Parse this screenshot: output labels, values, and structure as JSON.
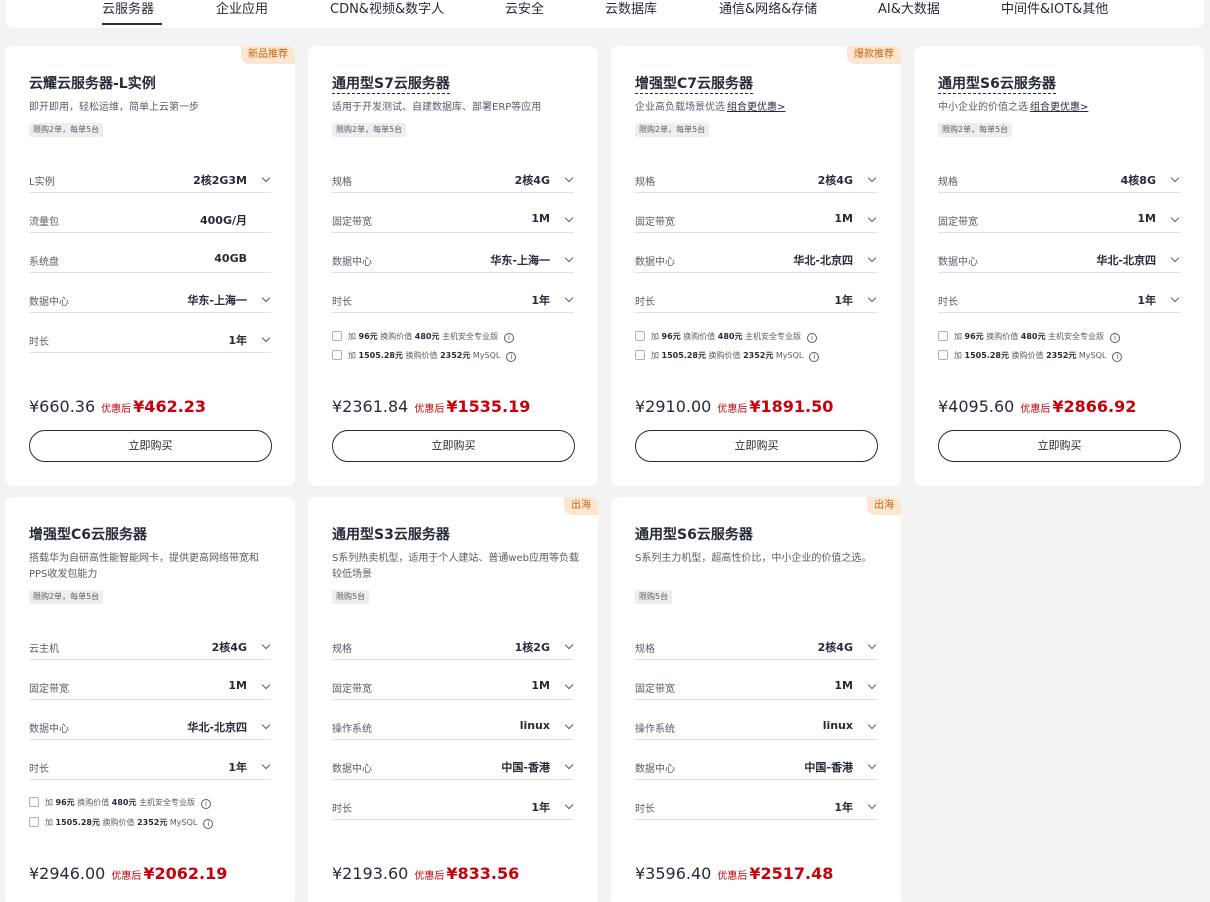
{
  "tabs": [
    {
      "label": "云服务器",
      "active": true
    },
    {
      "label": "企业应用",
      "active": false
    },
    {
      "label": "CDN&视频&数字人",
      "active": false
    },
    {
      "label": "云安全",
      "active": false
    },
    {
      "label": "云数据库",
      "active": false
    },
    {
      "label": "通信&网络&存储",
      "active": false
    },
    {
      "label": "AI&大数据",
      "active": false
    },
    {
      "label": "中间件&IOT&其他",
      "active": false
    }
  ],
  "common": {
    "buy_label": "立即购买",
    "after_discount_label": "优惠后",
    "combo_link": "组合更优惠>",
    "addon_1_prefix": "加",
    "addon_1_price": "96元",
    "addon_1_mid": "换购价值",
    "addon_1_value": "480元",
    "addon_1_suffix": "主机安全专业版",
    "addon_2_prefix": "加",
    "addon_2_price": "1505.28元",
    "addon_2_mid": "换购价值",
    "addon_2_value": "2352元",
    "addon_2_suffix": "MySQL",
    "info_glyph": "i"
  },
  "colors": {
    "accent_red": "#c7000b",
    "badge_bg": "#fbe6d2",
    "badge_text": "#c7670e",
    "text_primary": "#252b3a"
  },
  "cards": [
    {
      "title": "云耀云服务器-L实例",
      "badge": "新品推荐",
      "desc": "即开即用，轻松运维，简单上云第一步",
      "limit": "限购2单，每单5台",
      "specs": [
        {
          "label": "L实例",
          "value": "2核2G3M"
        },
        {
          "label": "流量包",
          "value": "400G/月"
        },
        {
          "label": "系统盘",
          "value": "40GB"
        },
        {
          "label": "数据中心",
          "value": "华东-上海一"
        },
        {
          "label": "时长",
          "value": "1年"
        }
      ],
      "orig_price": "¥660.36",
      "final_price": "¥462.23"
    },
    {
      "title": "通用型S7云服务器",
      "badge": "",
      "desc": "适用于开发测试、自建数据库、部署ERP等应用",
      "limit": "限购2单，每单5台",
      "specs": [
        {
          "label": "规格",
          "value": "2核4G"
        },
        {
          "label": "固定带宽",
          "value": "1M"
        },
        {
          "label": "数据中心",
          "value": "华东-上海一"
        },
        {
          "label": "时长",
          "value": "1年"
        }
      ],
      "orig_price": "¥2361.84",
      "final_price": "¥1535.19"
    },
    {
      "title": "增强型C7云服务器",
      "badge": "爆款推荐",
      "desc": "企业高负载场景优选",
      "limit": "限购2单，每单5台",
      "specs": [
        {
          "label": "规格",
          "value": "2核4G"
        },
        {
          "label": "固定带宽",
          "value": "1M"
        },
        {
          "label": "数据中心",
          "value": "华北-北京四"
        },
        {
          "label": "时长",
          "value": "1年"
        }
      ],
      "orig_price": "¥2910.00",
      "final_price": "¥1891.50"
    },
    {
      "title": "通用型S6云服务器",
      "badge": "",
      "desc": "中小企业的价值之选",
      "limit": "限购2单，每单5台",
      "specs": [
        {
          "label": "规格",
          "value": "4核8G"
        },
        {
          "label": "固定带宽",
          "value": "1M"
        },
        {
          "label": "数据中心",
          "value": "华北-北京四"
        },
        {
          "label": "时长",
          "value": "1年"
        }
      ],
      "orig_price": "¥4095.60",
      "final_price": "¥2866.92"
    },
    {
      "title": "增强型C6云服务器",
      "badge": "",
      "desc": "搭载华为自研高性能智能网卡，提供更高网络带宽和PPS收发包能力",
      "limit": "限购2单，每单5台",
      "specs": [
        {
          "label": "云主机",
          "value": "2核4G"
        },
        {
          "label": "固定带宽",
          "value": "1M"
        },
        {
          "label": "数据中心",
          "value": "华北-北京四"
        },
        {
          "label": "时长",
          "value": "1年"
        }
      ],
      "orig_price": "¥2946.00",
      "final_price": "¥2062.19"
    },
    {
      "title": "通用型S3云服务器",
      "badge": "出海",
      "desc": "S系列热卖机型，适用于个人建站、普通web应用等负载较低场景",
      "limit": "限购5台",
      "specs": [
        {
          "label": "规格",
          "value": "1核2G"
        },
        {
          "label": "固定带宽",
          "value": "1M"
        },
        {
          "label": "操作系统",
          "value": "linux"
        },
        {
          "label": "数据中心",
          "value": "中国-香港"
        },
        {
          "label": "时长",
          "value": "1年"
        }
      ],
      "orig_price": "¥2193.60",
      "final_price": "¥833.56"
    },
    {
      "title": "通用型S6云服务器",
      "badge": "出海",
      "desc": "S系列主力机型，超高性价比，中小企业的价值之选。",
      "limit": "限购5台",
      "specs": [
        {
          "label": "规格",
          "value": "2核4G"
        },
        {
          "label": "固定带宽",
          "value": "1M"
        },
        {
          "label": "操作系统",
          "value": "linux"
        },
        {
          "label": "数据中心",
          "value": "中国-香港"
        },
        {
          "label": "时长",
          "value": "1年"
        }
      ],
      "orig_price": "¥3596.40",
      "final_price": "¥2517.48"
    }
  ]
}
